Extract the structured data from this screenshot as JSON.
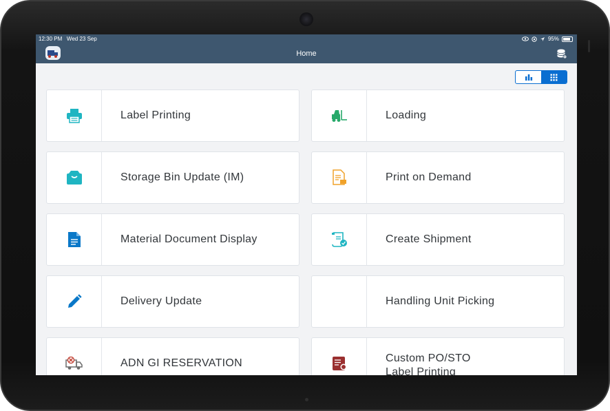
{
  "status_bar": {
    "time": "12:30 PM",
    "date": "Wed 23 Sep",
    "battery": "95%"
  },
  "header": {
    "title": "Home",
    "logo_icon": "forklift-truck-logo-icon",
    "right_icon": "database-settings-icon"
  },
  "view_toggle": {
    "options": [
      "chart-view-icon",
      "grid-view-icon"
    ],
    "active": "grid-view-icon",
    "accent_color": "#0a6ed1"
  },
  "tiles": [
    {
      "label": "Label Printing",
      "icon": "printer-icon",
      "color": "#1fb5c2"
    },
    {
      "label": "Loading",
      "icon": "forklift-icon",
      "color": "#27a96a"
    },
    {
      "label": "Storage Bin Update (IM)",
      "icon": "storage-box-icon",
      "color": "#1fb5c2"
    },
    {
      "label": "Print on Demand",
      "icon": "document-print-icon",
      "color": "#f0a22a"
    },
    {
      "label": "Material Document Display",
      "icon": "document-icon",
      "color": "#0a78c8"
    },
    {
      "label": "Create Shipment",
      "icon": "shipment-scroll-icon",
      "color": "#1fb5c2"
    },
    {
      "label": "Delivery Update",
      "icon": "pencil-icon",
      "color": "#0a78c8"
    },
    {
      "label": "Handling Unit Picking",
      "icon": "",
      "color": ""
    },
    {
      "label": "ADN GI RESERVATION",
      "icon": "delivery-truck-icon",
      "color": "#6b6b6b"
    },
    {
      "label": "Custom PO/STO Label Printing",
      "icon": "custom-label-icon",
      "color": "#9a2f2f"
    }
  ],
  "colors": {
    "header_bg": "#3e576f",
    "screen_bg": "#f2f3f5",
    "text": "#32363a"
  }
}
